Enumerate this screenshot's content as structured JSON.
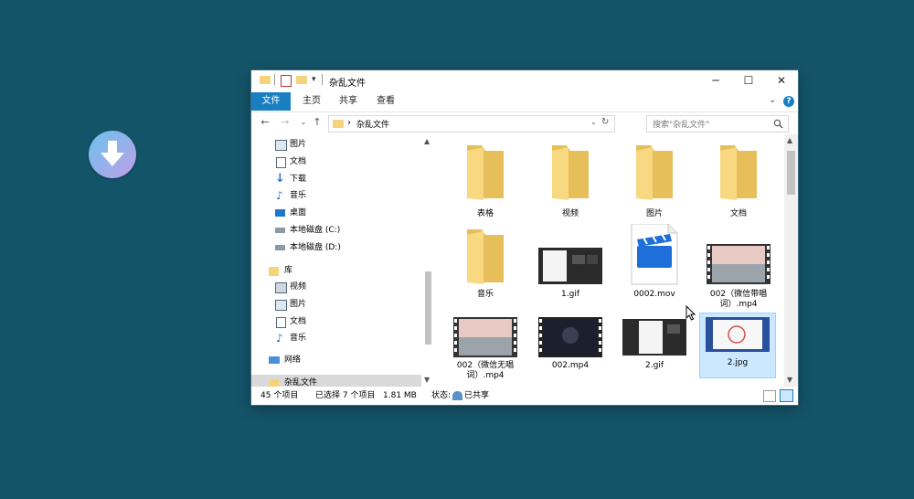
{
  "window": {
    "title": "杂乱文件",
    "controls": {
      "minimize": "─",
      "maximize": "☐",
      "close": "✕"
    }
  },
  "ribbon": {
    "tabs": [
      {
        "label": "文件",
        "active": true
      },
      {
        "label": "主页",
        "active": false
      },
      {
        "label": "共享",
        "active": false
      },
      {
        "label": "查看",
        "active": false
      }
    ],
    "help": "?"
  },
  "address": {
    "path": "杂乱文件",
    "separator": "›",
    "search_placeholder": "搜索\"杂乱文件\""
  },
  "nav_pane": {
    "quick_items": [
      {
        "label": "图片",
        "icon": "pictures-icon"
      },
      {
        "label": "文档",
        "icon": "documents-icon"
      },
      {
        "label": "下载",
        "icon": "download-icon"
      },
      {
        "label": "音乐",
        "icon": "music-icon"
      },
      {
        "label": "桌面",
        "icon": "desktop-icon"
      },
      {
        "label": "本地磁盘 (C:)",
        "icon": "drive-icon"
      },
      {
        "label": "本地磁盘 (D:)",
        "icon": "drive-icon"
      }
    ],
    "library": {
      "label": "库"
    },
    "library_items": [
      {
        "label": "视频",
        "icon": "videos-icon"
      },
      {
        "label": "图片",
        "icon": "pictures-icon"
      },
      {
        "label": "文档",
        "icon": "documents-icon"
      },
      {
        "label": "音乐",
        "icon": "music-icon"
      }
    ],
    "network": {
      "label": "网络"
    },
    "current_folder": {
      "label": "杂乱文件"
    }
  },
  "files": [
    {
      "name": "表格",
      "type": "folder"
    },
    {
      "name": "视频",
      "type": "folder"
    },
    {
      "name": "图片",
      "type": "folder"
    },
    {
      "name": "文档",
      "type": "folder"
    },
    {
      "name": "音乐",
      "type": "folder"
    },
    {
      "name": "1.gif",
      "type": "gif"
    },
    {
      "name": "0002.mov",
      "type": "mov"
    },
    {
      "name": "002（微信带唱词）.mp4",
      "line1": "002（微信带唱",
      "line2": "词）.mp4",
      "type": "video"
    },
    {
      "name": "002（微信无唱词）.mp4",
      "line1": "002（微信无唱",
      "line2": "词）.mp4",
      "type": "video"
    },
    {
      "name": "002.mp4",
      "type": "video"
    },
    {
      "name": "2.gif",
      "type": "gif"
    },
    {
      "name": "2.jpg",
      "type": "jpg",
      "selected": true
    }
  ],
  "status": {
    "count": "45 个项目",
    "selection": "已选择 7 个项目",
    "size": "1.81 MB",
    "state_label": "状态:",
    "state_value": "已共享"
  },
  "colors": {
    "desktop": "#145469",
    "accent": "#1a7fc1",
    "folder": "#f4d37a",
    "selection": "#cce8ff"
  }
}
